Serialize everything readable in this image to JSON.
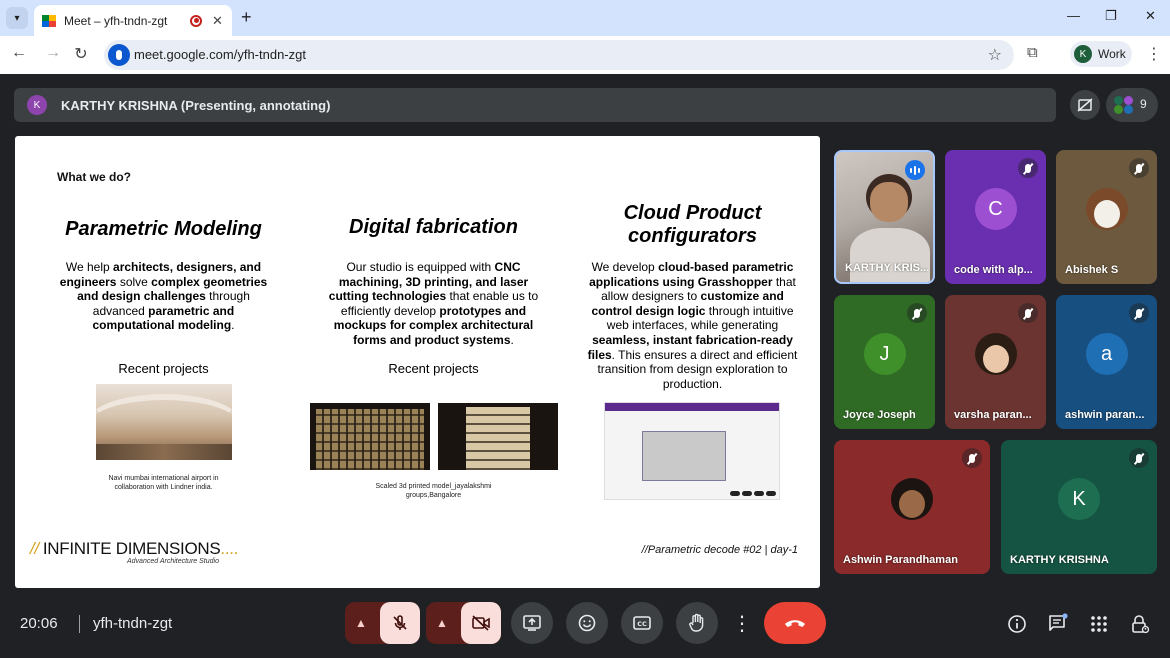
{
  "browser": {
    "tab_title": "Meet – yfh-tndn-zgt",
    "new_tab": "+",
    "url": "meet.google.com/yfh-tndn-zgt",
    "profile_initial": "K",
    "profile_label": "Work",
    "win_minimize": "—",
    "win_restore": "❐",
    "win_close": "✕"
  },
  "meet": {
    "presenter_initial": "K",
    "presenter_text": "KARTHY KRISHNA (Presenting, annotating)",
    "participant_count": "9",
    "clock": "20:06",
    "meeting_code": "yfh-tndn-zgt"
  },
  "slide": {
    "heading": "What we do?",
    "columns": [
      {
        "title": "Parametric Modeling",
        "body_html": "We help <b>architects, designers, and engineers</b> solve <b>complex geometries and design challenges</b> through advanced <b>parametric and computational modeling</b>.",
        "recent": "Recent projects",
        "caption": "Navi mumbai international airport in collaboration with Lindner india."
      },
      {
        "title": "Digital fabrication",
        "body_html": "Our studio is equipped with <b>CNC machining, 3D printing, and laser cutting technologies</b> that enable us to efficiently develop <b>prototypes and mockups for complex architectural forms and product systems</b>.",
        "recent": "Recent projects",
        "caption": "Scaled 3d printed model_jayalakshmi groups,Bangalore"
      },
      {
        "title": "Cloud Product configurators",
        "body_html": "We develop <b>cloud-based parametric applications using Grasshopper</b> that allow designers to <b>customize and control design logic</b> through intuitive web interfaces, while generating <b>seamless, instant fabrication-ready files</b>. This ensures a direct and efficient transition from design exploration to production.",
        "recent": "",
        "caption": ""
      }
    ],
    "logo_slashes": "//",
    "logo_text": "INFINITE DIMENSIONS",
    "logo_dots": "....",
    "logo_sub": "Advanced Architecture Studio",
    "footer": "//Parametric decode #02 | day-1"
  },
  "participants": [
    {
      "name": "KARTHY KRIS...",
      "type": "video",
      "speaking": true
    },
    {
      "name": "code with alp...",
      "initial": "C",
      "avatar_color": "#9c4fd0",
      "bg": "#6a2fb0",
      "muted": true
    },
    {
      "name": "Abishek S",
      "type": "photo-dog",
      "bg": "#6d5a3e",
      "muted": true
    },
    {
      "name": "Joyce Joseph",
      "initial": "J",
      "avatar_color": "#3f8f2a",
      "bg": "#2f6b24",
      "muted": true
    },
    {
      "name": "varsha paran...",
      "type": "photo-person",
      "bg": "#6b3430",
      "muted": true
    },
    {
      "name": "ashwin paran...",
      "initial": "a",
      "avatar_color": "#1f6fb5",
      "bg": "#174f80",
      "muted": true
    },
    {
      "name": "Ashwin Parandhaman",
      "type": "photo-boy",
      "bg": "#8a2a2a",
      "muted": true
    },
    {
      "name": "KARTHY KRISHNA",
      "initial": "K",
      "avatar_color": "#1e6e52",
      "bg": "#155442",
      "muted": true
    }
  ],
  "colors": {
    "end_call": "#ea4335",
    "mic_off_bg": "#f9dedc",
    "tab_strip": "#d3e3fd",
    "logo_accent": "#d6a21a"
  }
}
